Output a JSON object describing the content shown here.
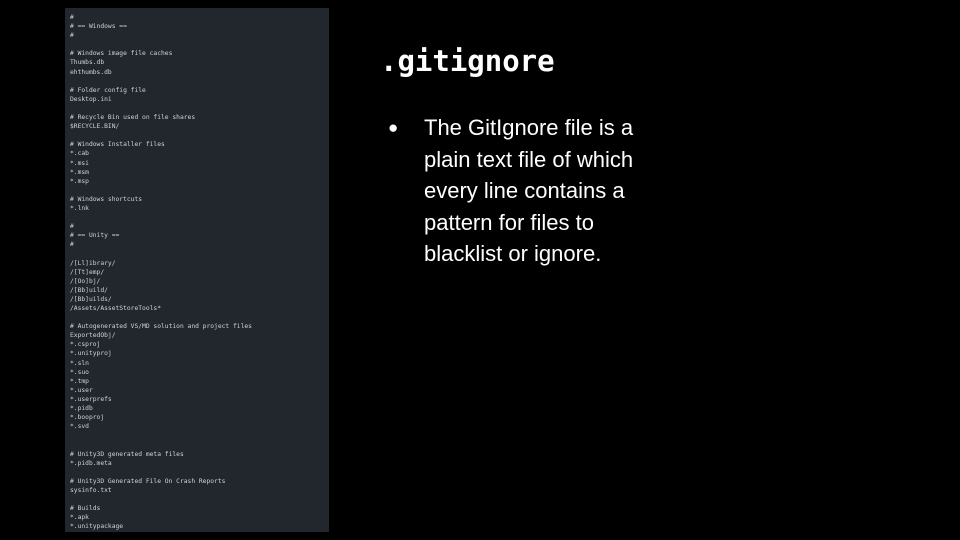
{
  "slide": {
    "title": ".gitignore",
    "bullets": [
      {
        "marker": "●",
        "text": "The GitIgnore file is a plain text file of which every line contains a pattern for files to blacklist or ignore."
      }
    ]
  },
  "code_panel": {
    "background": "#22272e",
    "lines": [
      "#",
      "# == Windows ==",
      "#",
      "",
      "# Windows image file caches",
      "Thumbs.db",
      "ehthumbs.db",
      "",
      "# Folder config file",
      "Desktop.ini",
      "",
      "# Recycle Bin used on file shares",
      "$RECYCLE.BIN/",
      "",
      "# Windows Installer files",
      "*.cab",
      "*.msi",
      "*.msm",
      "*.msp",
      "",
      "# Windows shortcuts",
      "*.lnk",
      "",
      "#",
      "# == Unity ==",
      "#",
      "",
      "/[Ll]ibrary/",
      "/[Tt]emp/",
      "/[Oo]bj/",
      "/[Bb]uild/",
      "/[Bb]uilds/",
      "/Assets/AssetStoreTools*",
      "",
      "# Autogenerated VS/MD solution and project files",
      "ExportedObj/",
      "*.csproj",
      "*.unityproj",
      "*.sln",
      "*.suo",
      "*.tmp",
      "*.user",
      "*.userprefs",
      "*.pidb",
      "*.booproj",
      "*.svd",
      "",
      "",
      "# Unity3D generated meta files",
      "*.pidb.meta",
      "",
      "# Unity3D Generated File On Crash Reports",
      "sysinfo.txt",
      "",
      "# Builds",
      "*.apk",
      "*.unitypackage"
    ]
  }
}
